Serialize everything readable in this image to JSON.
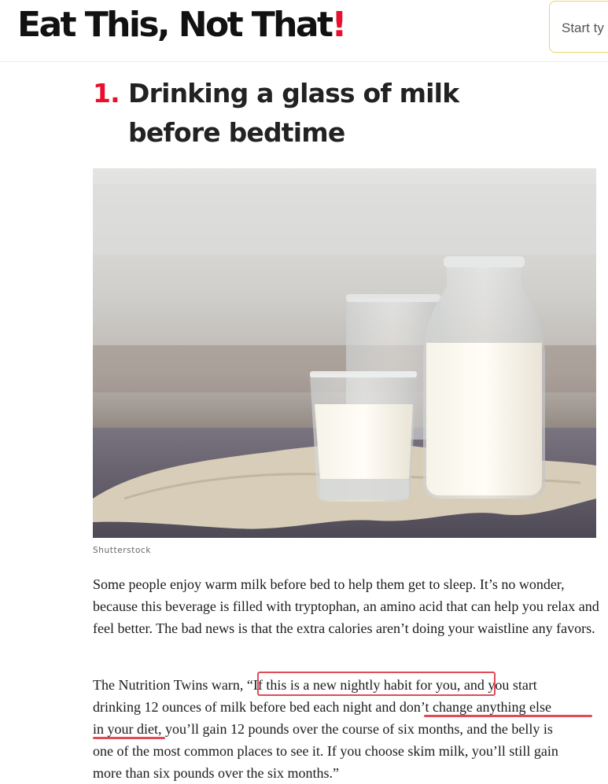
{
  "header": {
    "logo_main": "Eat This, Not That",
    "logo_bang": "!",
    "search_placeholder": "Start ty"
  },
  "article": {
    "item_number": "1.",
    "headline": "Drinking a glass of milk before bedtime",
    "image_credit": "Shutterstock",
    "paragraph1": "Some people enjoy warm milk before bed to help them get to sleep. It’s no wonder, because this beverage is filled with tryptophan, an amino acid that can help you relax and feel better. The bad news is that the extra calories aren’t doing your waistline any favors.",
    "paragraph2_lines": [
      "The Nutrition Twins warn, “If this is a new nightly habit for you, and you start",
      "drinking 12 ounces of milk before bed each night and don’t change anything else",
      "in your diet, you’ll gain 12 pounds over the course of six months, and the belly is",
      "one of the most common places to see it. If you choose skim milk, you’ll still gain",
      "more than six pounds over the six months.”"
    ]
  },
  "annotations": {
    "highlight_color": "#e24a55"
  },
  "colors": {
    "brand_red": "#e8112d",
    "search_border": "#f0d267"
  }
}
